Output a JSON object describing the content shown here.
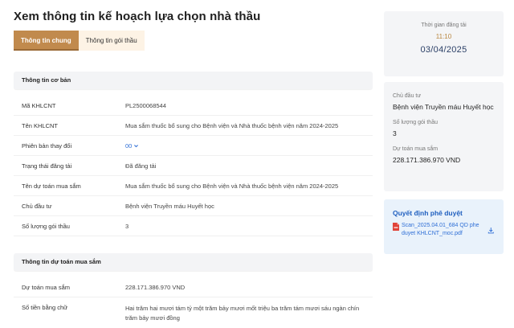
{
  "page": {
    "title": "Xem thông tin kế hoạch lựa chọn nhà thầu"
  },
  "tabs": [
    {
      "label": "Thông tin chung",
      "active": true
    },
    {
      "label": "Thông tin gói thầu",
      "active": false
    }
  ],
  "basic_info": {
    "heading": "Thông tin cơ bản",
    "rows": [
      {
        "label": "Mã KHLCNT",
        "value": "PL2500068544"
      },
      {
        "label": "Tên KHLCNT",
        "value": "Mua sắm thuốc bổ sung cho Bệnh viện và Nhà thuốc bệnh viện năm 2024-2025"
      },
      {
        "label": "Phiên bản thay đổi",
        "value": "00"
      },
      {
        "label": "Trạng thái đăng tải",
        "value": "Đã đăng tải"
      },
      {
        "label": "Tên dự toán mua sắm",
        "value": "Mua sắm thuốc bổ sung cho Bệnh viện và Nhà thuốc bệnh viện năm 2024-2025"
      },
      {
        "label": "Chủ đầu tư",
        "value": "Bệnh viện Truyền máu Huyết học"
      },
      {
        "label": "Số lượng gói thầu",
        "value": "3"
      }
    ]
  },
  "budget_info": {
    "heading": "Thông tin dự toán mua sắm",
    "rows": [
      {
        "label": "Dự toán mua sắm",
        "value": "228.171.386.970 VND"
      },
      {
        "label": "Số tiền bằng chữ",
        "value": "Hai trăm hai mươi tám tỷ một trăm bảy mươi mốt triệu ba trăm tám mươi sáu ngàn chín trăm bảy mươi đồng"
      }
    ]
  },
  "posting": {
    "label": "Thời gian đăng tải",
    "time": "11:10",
    "date": "03/04/2025"
  },
  "summary": {
    "investor_label": "Chủ đầu tư",
    "investor_value": "Bệnh viện Truyền máu Huyết học",
    "packages_label": "Số lượng gói thầu",
    "packages_value": "3",
    "budget_label": "Dự toán mua sắm",
    "budget_value": "228.171.386.970 VND"
  },
  "decision": {
    "title": "Quyết định phê duyệt",
    "file_name": "Scan_2025.04.01_684 QD phe duyet KHLCNT_moc.pdf",
    "icons": [
      "pdf-icon",
      "download-icon"
    ]
  },
  "colors": {
    "accent": "#c18a4d",
    "link": "#2f6fd6",
    "date": "#2a3f66"
  }
}
